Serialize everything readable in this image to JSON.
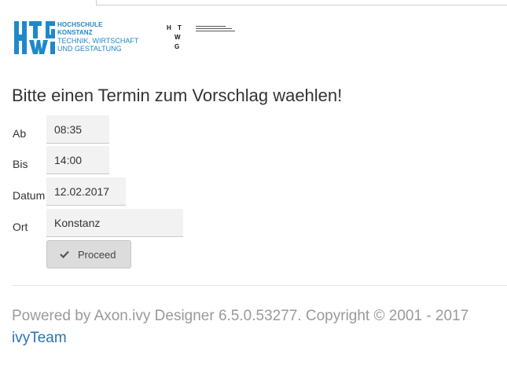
{
  "logos": {
    "hochschule_line1": "HOCHSCHULE",
    "hochschule_line2": "KONSTANZ",
    "hochschule_line3": "TECHNIK, WIRTSCHAFT",
    "hochschule_line4": "UND GESTALTUNG",
    "htwg_letters": [
      "H",
      "T",
      "W",
      "G"
    ]
  },
  "form": {
    "heading": "Bitte einen Termin zum Vorschlag waehlen!",
    "fields": [
      {
        "label": "Ab",
        "value": "08:35"
      },
      {
        "label": "Bis",
        "value": "14:00"
      },
      {
        "label": "Datum",
        "value": "12.02.2017"
      },
      {
        "label": "Ort",
        "value": "Konstanz"
      }
    ],
    "proceed_label": "Proceed"
  },
  "footer": {
    "text": "Powered by Axon.ivy Designer 6.5.0.53277. Copyright © 2001 - 2017",
    "link": "ivyTeam"
  },
  "colors": {
    "brand_blue": "#1f88c9",
    "link_blue": "#2a73b8",
    "field_bg": "#f2f2f2"
  }
}
